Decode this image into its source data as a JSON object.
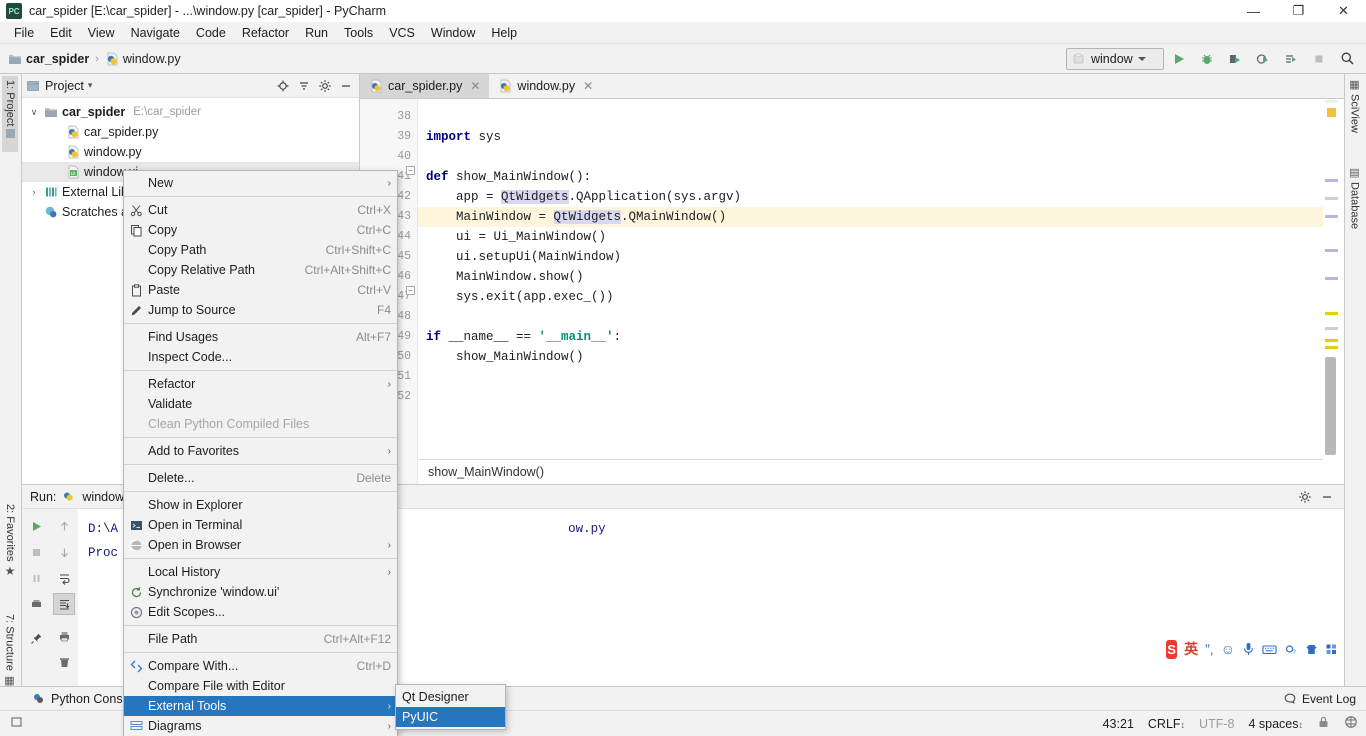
{
  "window": {
    "title": "car_spider [E:\\car_spider] - ...\\window.py [car_spider] - PyCharm",
    "app_icon": "pycharm-icon",
    "minimize": "—",
    "maximize": "❐",
    "close": "✕"
  },
  "menubar": [
    {
      "label": "File"
    },
    {
      "label": "Edit"
    },
    {
      "label": "View"
    },
    {
      "label": "Navigate"
    },
    {
      "label": "Code"
    },
    {
      "label": "Refactor"
    },
    {
      "label": "Run"
    },
    {
      "label": "Tools"
    },
    {
      "label": "VCS"
    },
    {
      "label": "Window"
    },
    {
      "label": "Help"
    }
  ],
  "navbar": {
    "crumbs": [
      {
        "label": "car_spider",
        "icon": "folder-icon"
      },
      {
        "label": "window.py",
        "icon": "python-file-icon"
      }
    ],
    "separator": "›",
    "run_config": "window",
    "run_config_icon": "python-config-icon",
    "buttons": [
      {
        "name": "run-button",
        "icon": "play-icon"
      },
      {
        "name": "debug-button",
        "icon": "bug-icon"
      },
      {
        "name": "run-coverage-button",
        "icon": "run-coverage-icon"
      },
      {
        "name": "profile-button",
        "icon": "profile-icon"
      },
      {
        "name": "run-with-options-button",
        "icon": "run-list-icon"
      },
      {
        "name": "stop-button",
        "icon": "stop-icon"
      },
      {
        "name": "search-everywhere-button",
        "icon": "search-icon"
      }
    ]
  },
  "rails": {
    "left": [
      {
        "label": "1: Project",
        "selected": true
      },
      {
        "label": "2: Favorites",
        "selected": false
      },
      {
        "label": "7: Structure",
        "selected": false
      }
    ],
    "right": [
      {
        "label": "SciView"
      },
      {
        "label": "Database"
      }
    ]
  },
  "project_panel": {
    "title": "Project",
    "title_caret": "▾",
    "actions": [
      {
        "name": "locate-icon",
        "glyph": "⊕"
      },
      {
        "name": "collapse-all-icon",
        "glyph": "≃"
      },
      {
        "name": "settings-gear-icon",
        "glyph": "⚙"
      },
      {
        "name": "hide-panel-icon",
        "glyph": "—"
      }
    ],
    "tree": [
      {
        "label": "car_spider",
        "path": "E:\\car_spider",
        "twist": "∨",
        "icon": "folder-icon",
        "indent": 0,
        "bold": true,
        "selected": false
      },
      {
        "label": "car_spider.py",
        "path": "",
        "twist": "",
        "icon": "python-file-icon",
        "indent": 1,
        "bold": false,
        "selected": false
      },
      {
        "label": "window.py",
        "path": "",
        "twist": "",
        "icon": "python-file-icon",
        "indent": 1,
        "bold": false,
        "selected": false
      },
      {
        "label": "window.ui",
        "path": "",
        "twist": "",
        "icon": "ui-file-icon",
        "indent": 1,
        "bold": false,
        "selected": true
      },
      {
        "label": "External Libraries",
        "path": "",
        "twist": "›",
        "icon": "library-icon",
        "indent": 0,
        "bold": false,
        "selected": false
      },
      {
        "label": "Scratches and Consoles",
        "path": "",
        "twist": "",
        "icon": "scratches-icon",
        "indent": 0,
        "bold": false,
        "selected": false
      }
    ]
  },
  "editor": {
    "tabs": [
      {
        "label": "car_spider.py",
        "icon": "python-file-icon",
        "active": true,
        "close": "✕"
      },
      {
        "label": "window.py",
        "icon": "python-file-icon",
        "active": false,
        "close": "✕"
      }
    ],
    "line_numbers": [
      "38",
      "39",
      "40",
      "41",
      "42",
      "43",
      "44",
      "45",
      "46",
      "47",
      "48",
      "49",
      "50",
      "51",
      "52"
    ],
    "lines": [
      {
        "tokens": [],
        "highlight": false
      },
      {
        "tokens": [
          {
            "t": "import ",
            "c": "kw"
          },
          {
            "t": "sys",
            "c": ""
          }
        ],
        "highlight": false
      },
      {
        "tokens": [],
        "highlight": false
      },
      {
        "tokens": [
          {
            "t": "def ",
            "c": "kw"
          },
          {
            "t": "show_MainWindow():",
            "c": ""
          }
        ],
        "highlight": false
      },
      {
        "tokens": [
          {
            "t": "    app = ",
            "c": ""
          },
          {
            "t": "QtWidgets",
            "c": "occ"
          },
          {
            "t": ".QApplication(sys.argv)",
            "c": ""
          }
        ],
        "highlight": false
      },
      {
        "tokens": [
          {
            "t": "    MainWindow = ",
            "c": ""
          },
          {
            "t": "QtWidgets",
            "c": "occ"
          },
          {
            "t": ".QMainWindow()",
            "c": ""
          }
        ],
        "highlight": true
      },
      {
        "tokens": [
          {
            "t": "    ui = Ui_MainWindow()",
            "c": ""
          }
        ],
        "highlight": false
      },
      {
        "tokens": [
          {
            "t": "    ui.setupUi(MainWindow)",
            "c": ""
          }
        ],
        "highlight": false
      },
      {
        "tokens": [
          {
            "t": "    MainWindow.show()",
            "c": ""
          }
        ],
        "highlight": false
      },
      {
        "tokens": [
          {
            "t": "    sys.exit(app.exec_())",
            "c": ""
          }
        ],
        "highlight": false
      },
      {
        "tokens": [],
        "highlight": false
      },
      {
        "tokens": [
          {
            "t": "if ",
            "c": "kw"
          },
          {
            "t": "__name__ == ",
            "c": ""
          },
          {
            "t": "'__main__'",
            "c": "str"
          },
          {
            "t": ":",
            "c": ""
          }
        ],
        "highlight": false
      },
      {
        "tokens": [
          {
            "t": "    show_MainWindow()",
            "c": ""
          }
        ],
        "highlight": false
      }
    ],
    "breadcrumb": "show_MainWindow()"
  },
  "run_window": {
    "label": "Run:",
    "config_name": "window",
    "config_icon": "python-config-icon",
    "console_lines": [
      "D:\\A                                                            ow.py",
      "Proc"
    ],
    "left_tools": [
      {
        "name": "rerun-icon",
        "glyph": "▶",
        "selected": false
      },
      {
        "name": "stop-icon",
        "glyph": "■",
        "selected": false
      },
      {
        "name": "pause-icon",
        "glyph": "‖",
        "selected": false
      },
      {
        "name": "print-output-icon",
        "glyph": "▤",
        "selected": false
      },
      {
        "name": "pin-tab-icon",
        "glyph": "✐",
        "selected": false
      }
    ],
    "right_tools": [
      {
        "name": "up-arrow-icon",
        "glyph": "↑",
        "selected": false
      },
      {
        "name": "down-arrow-icon",
        "glyph": "↓",
        "selected": false
      },
      {
        "name": "soft-wrap-icon",
        "glyph": "↩",
        "selected": false
      },
      {
        "name": "scroll-to-end-icon",
        "glyph": "⤓",
        "selected": true
      },
      {
        "name": "print-icon",
        "glyph": "⎙",
        "selected": false
      },
      {
        "name": "clear-all-icon",
        "glyph": "Ὕ1",
        "selected": false
      }
    ],
    "header_right": [
      {
        "name": "settings-gear-icon",
        "glyph": "⚙"
      },
      {
        "name": "hide-panel-icon",
        "glyph": "—"
      }
    ]
  },
  "bottom_strip": {
    "left_items": [
      {
        "label": "Python Console",
        "icon": "python-console-icon"
      }
    ],
    "right_items": [
      {
        "label": "Event Log",
        "icon": "event-log-icon"
      }
    ]
  },
  "statusbar": {
    "caret_position": "43:21",
    "line_separator": "CRLF",
    "encoding": "UTF-8",
    "indent": "4 spaces",
    "lock_icon": "lock-icon",
    "inspection_icon": "inspection-icon"
  },
  "context_menu": {
    "items": [
      {
        "label": "New",
        "accel": "",
        "icon": "",
        "submenu": true,
        "separator_after": true,
        "disabled": false,
        "selected": false
      },
      {
        "label": "Cut",
        "accel": "Ctrl+X",
        "icon": "scissors-icon",
        "submenu": false,
        "separator_after": false,
        "disabled": false,
        "selected": false
      },
      {
        "label": "Copy",
        "accel": "Ctrl+C",
        "icon": "copy-icon",
        "submenu": false,
        "separator_after": false,
        "disabled": false,
        "selected": false
      },
      {
        "label": "Copy Path",
        "accel": "Ctrl+Shift+C",
        "icon": "",
        "submenu": false,
        "separator_after": false,
        "disabled": false,
        "selected": false
      },
      {
        "label": "Copy Relative Path",
        "accel": "Ctrl+Alt+Shift+C",
        "icon": "",
        "submenu": false,
        "separator_after": false,
        "disabled": false,
        "selected": false
      },
      {
        "label": "Paste",
        "accel": "Ctrl+V",
        "icon": "clipboard-icon",
        "submenu": false,
        "separator_after": false,
        "disabled": false,
        "selected": false
      },
      {
        "label": "Jump to Source",
        "accel": "F4",
        "icon": "pencil-icon",
        "submenu": false,
        "separator_after": true,
        "disabled": false,
        "selected": false
      },
      {
        "label": "Find Usages",
        "accel": "Alt+F7",
        "icon": "",
        "submenu": false,
        "separator_after": false,
        "disabled": false,
        "selected": false
      },
      {
        "label": "Inspect Code...",
        "accel": "",
        "icon": "",
        "submenu": false,
        "separator_after": true,
        "disabled": false,
        "selected": false
      },
      {
        "label": "Refactor",
        "accel": "",
        "icon": "",
        "submenu": true,
        "separator_after": false,
        "disabled": false,
        "selected": false
      },
      {
        "label": "Validate",
        "accel": "",
        "icon": "",
        "submenu": false,
        "separator_after": false,
        "disabled": false,
        "selected": false
      },
      {
        "label": "Clean Python Compiled Files",
        "accel": "",
        "icon": "",
        "submenu": false,
        "separator_after": true,
        "disabled": true,
        "selected": false
      },
      {
        "label": "Add to Favorites",
        "accel": "",
        "icon": "",
        "submenu": true,
        "separator_after": true,
        "disabled": false,
        "selected": false
      },
      {
        "label": "Delete...",
        "accel": "Delete",
        "icon": "",
        "submenu": false,
        "separator_after": true,
        "disabled": false,
        "selected": false
      },
      {
        "label": "Show in Explorer",
        "accel": "",
        "icon": "",
        "submenu": false,
        "separator_after": false,
        "disabled": false,
        "selected": false
      },
      {
        "label": "Open in Terminal",
        "accel": "",
        "icon": "terminal-icon",
        "submenu": false,
        "separator_after": false,
        "disabled": false,
        "selected": false
      },
      {
        "label": "Open in Browser",
        "accel": "",
        "icon": "browser-icon",
        "submenu": true,
        "separator_after": true,
        "disabled": false,
        "selected": false
      },
      {
        "label": "Local History",
        "accel": "",
        "icon": "",
        "submenu": true,
        "separator_after": false,
        "disabled": false,
        "selected": false
      },
      {
        "label": "Synchronize 'window.ui'",
        "accel": "",
        "icon": "sync-icon",
        "submenu": false,
        "separator_after": false,
        "disabled": false,
        "selected": false
      },
      {
        "label": "Edit Scopes...",
        "accel": "",
        "icon": "scopes-icon",
        "submenu": false,
        "separator_after": true,
        "disabled": false,
        "selected": false
      },
      {
        "label": "File Path",
        "accel": "Ctrl+Alt+F12",
        "icon": "",
        "submenu": false,
        "separator_after": true,
        "disabled": false,
        "selected": false
      },
      {
        "label": "Compare With...",
        "accel": "Ctrl+D",
        "icon": "compare-icon",
        "submenu": false,
        "separator_after": false,
        "disabled": false,
        "selected": false
      },
      {
        "label": "Compare File with Editor",
        "accel": "",
        "icon": "",
        "submenu": false,
        "separator_after": false,
        "disabled": false,
        "selected": false
      },
      {
        "label": "External Tools",
        "accel": "",
        "icon": "",
        "submenu": true,
        "separator_after": false,
        "disabled": false,
        "selected": true
      },
      {
        "label": "Diagrams",
        "accel": "",
        "icon": "diagrams-icon",
        "submenu": true,
        "separator_after": false,
        "disabled": false,
        "selected": false
      }
    ]
  },
  "submenu": {
    "items": [
      {
        "label": "Qt Designer",
        "selected": false
      },
      {
        "label": "PyUIC",
        "selected": true
      }
    ]
  },
  "ime": {
    "logo": "S",
    "mode": "英",
    "items": [
      {
        "name": "punctuation-icon",
        "glyph": "”,"
      },
      {
        "name": "emoji-icon",
        "glyph": "☺"
      },
      {
        "name": "microphone-icon",
        "glyph": "⚇"
      },
      {
        "name": "soft-keyboard-icon",
        "glyph": "⌨"
      },
      {
        "name": "toolbox-icon",
        "glyph": "⛭"
      },
      {
        "name": "skin-icon",
        "glyph": "☂"
      },
      {
        "name": "apps-icon",
        "glyph": "▦"
      }
    ]
  },
  "colors": {
    "accent_blue": "#2675bf",
    "green_run": "#4caf50",
    "selection_gray": "#e8e8e8",
    "highlight_line": "#fdf6dd",
    "occurrence": "#d8d8f0",
    "keyword": "#000080",
    "string": "#0a8f6e"
  }
}
